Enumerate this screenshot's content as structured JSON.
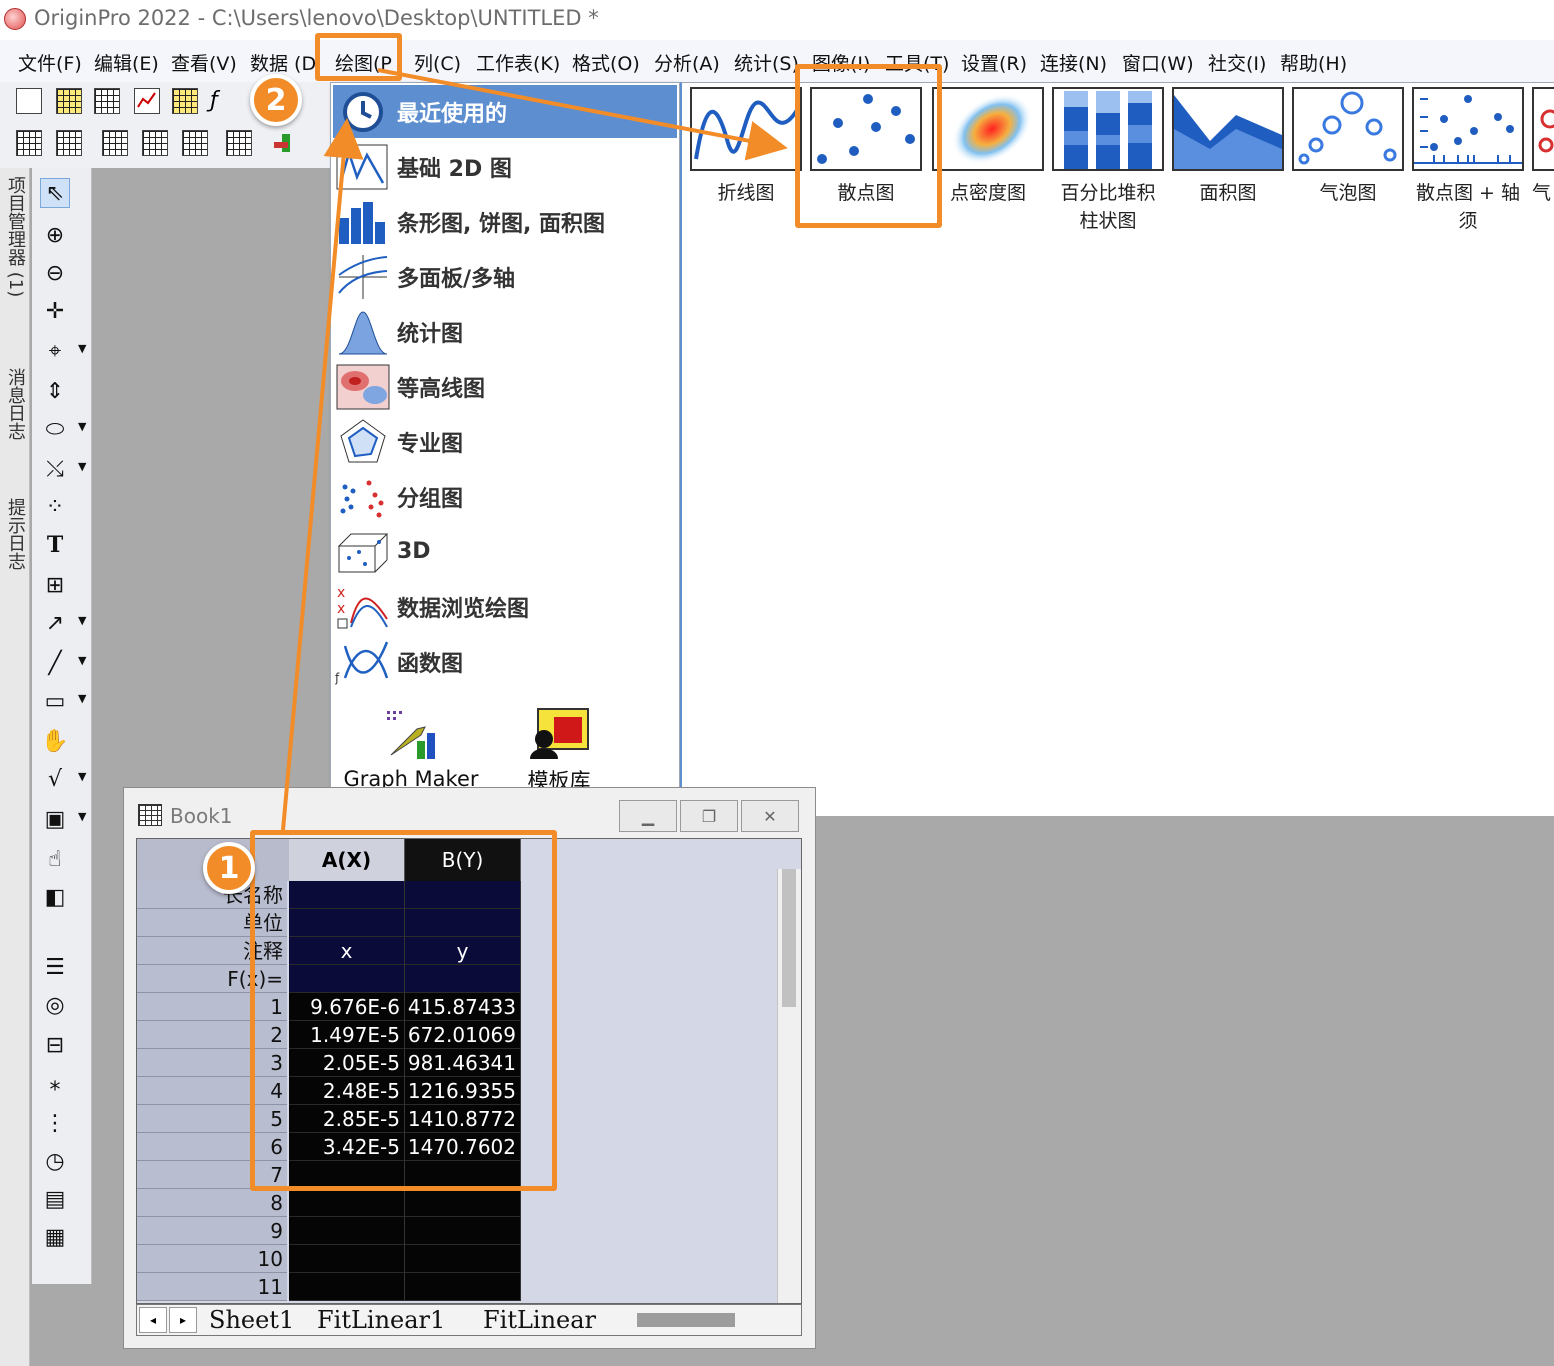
{
  "window": {
    "title": "OriginPro 2022 - C:\\Users\\lenovo\\Desktop\\UNTITLED *"
  },
  "menu": {
    "items": [
      "文件(F)",
      "编辑(E)",
      "查看(V)",
      "数据 (D",
      "绘图(P",
      "列(C)",
      "工作表(K)",
      "格式(O)",
      "分析(A)",
      "统计(S)",
      "图像(I)",
      "工具(T)",
      "设置(R)",
      "连接(N)",
      "窗口(W)",
      "社交(I)",
      "帮助(H)"
    ]
  },
  "side_panels": {
    "project": "项目管理器 (1)",
    "messages": "消息日志",
    "hints": "提示日志"
  },
  "plot_menu": {
    "items": [
      "最近使用的",
      "基础 2D 图",
      "条形图, 饼图, 面积图",
      "多面板/多轴",
      "统计图",
      "等高线图",
      "专业图",
      "分组图",
      "3D",
      "数据浏览绘图",
      "函数图"
    ],
    "graph_maker": "Graph Maker",
    "template_lib": "模板库"
  },
  "gallery": {
    "items": [
      "折线图",
      "散点图",
      "点密度图",
      "百分比堆积柱状图",
      "面积图",
      "气泡图",
      "散点图 + 轴须",
      "气"
    ]
  },
  "book": {
    "title": "Book1",
    "col_a": "A(X)",
    "col_b": "B(Y)",
    "meta_labels": [
      "长名称",
      "单位",
      "注释",
      "F(x)="
    ],
    "meta_a": [
      "",
      "",
      "x",
      ""
    ],
    "meta_b": [
      "",
      "",
      "y",
      ""
    ],
    "rows": [
      {
        "n": "1",
        "a": "9.676E-6",
        "b": "415.87433"
      },
      {
        "n": "2",
        "a": "1.497E-5",
        "b": "672.01069"
      },
      {
        "n": "3",
        "a": "2.05E-5",
        "b": "981.46341"
      },
      {
        "n": "4",
        "a": "2.48E-5",
        "b": "1216.9355"
      },
      {
        "n": "5",
        "a": "2.85E-5",
        "b": "1410.8772"
      },
      {
        "n": "6",
        "a": "3.42E-5",
        "b": "1470.7602"
      },
      {
        "n": "7",
        "a": "",
        "b": ""
      },
      {
        "n": "8",
        "a": "",
        "b": ""
      },
      {
        "n": "9",
        "a": "",
        "b": ""
      },
      {
        "n": "10",
        "a": "",
        "b": ""
      },
      {
        "n": "11",
        "a": "",
        "b": ""
      }
    ],
    "tabs": [
      "Sheet1",
      "FitLinear1",
      "FitLinear"
    ]
  },
  "badges": {
    "step1": "1",
    "step2": "2"
  },
  "colors": {
    "highlight": "#f28c28",
    "selection": "#5d8fd0",
    "data_bg": "#050505",
    "meta_bg": "#0b0b3a"
  }
}
